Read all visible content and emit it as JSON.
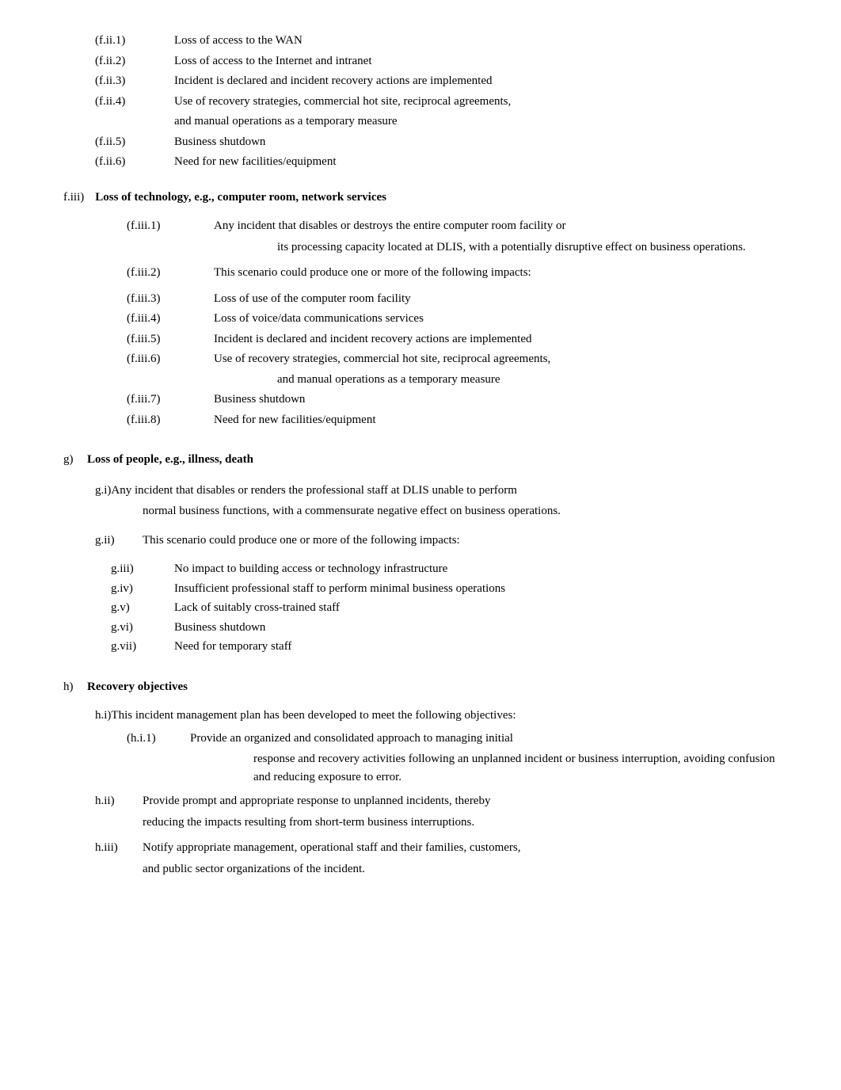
{
  "fii": {
    "items": [
      {
        "label": "(f.ii.1)",
        "text": "Loss of access to the WAN"
      },
      {
        "label": "(f.ii.2)",
        "text": "Loss of access to the Internet and intranet"
      },
      {
        "label": "(f.ii.3)",
        "text": "Incident is declared and incident recovery actions are implemented"
      },
      {
        "label": "(f.ii.4)",
        "text": "Use of recovery strategies, commercial hot site, reciprocal agreements,"
      },
      {
        "label": "",
        "continuation": "and manual operations as a temporary measure"
      },
      {
        "label": "(f.ii.5)",
        "text": "Business shutdown"
      },
      {
        "label": "(f.ii.6)",
        "text": "Need for new facilities/equipment"
      }
    ]
  },
  "fiii": {
    "header_label": "f.iii)",
    "header_title": "Loss of technology, e.g., computer room, network services",
    "items": [
      {
        "label": "(f.iii.1)",
        "text": "Any incident that disables or destroys the entire computer room facility or",
        "continuation": "its processing capacity located at DLIS, with a potentially disruptive effect on business operations."
      },
      {
        "label": "(f.iii.2)",
        "text": "This scenario could produce one or more of the following impacts:"
      },
      {
        "label": "(f.iii.3)",
        "text": "Loss of use of the computer room facility"
      },
      {
        "label": "(f.iii.4)",
        "text": "Loss of voice/data communications services"
      },
      {
        "label": "(f.iii.5)",
        "text": "Incident is declared and incident recovery actions are implemented"
      },
      {
        "label": "(f.iii.6)",
        "text": "Use of recovery strategies, commercial hot site, reciprocal agreements,"
      },
      {
        "label": "",
        "continuation": "and manual operations as a temporary measure"
      },
      {
        "label": "(f.iii.7)",
        "text": "Business shutdown"
      },
      {
        "label": "(f.iii.8)",
        "text": "Need for new facilities/equipment"
      }
    ]
  },
  "g": {
    "header_letter": "g)",
    "header_title": "Loss of people, e.g., illness, death",
    "gi_text": "g.i)Any incident that disables or renders the professional staff at DLIS unable to perform",
    "gi_continuation": "normal business functions, with a commensurate negative effect on business operations.",
    "gii_label": "g.ii)",
    "gii_text": "This scenario could produce one or more of the following impacts:",
    "impact_items": [
      {
        "label": "g.iii)",
        "text": "No impact to building access or technology infrastructure"
      },
      {
        "label": "g.iv)",
        "text": "Insufficient professional staff to perform minimal business operations"
      },
      {
        "label": "g.v)",
        "text": "Lack of suitably cross-trained staff"
      },
      {
        "label": "g.vi)",
        "text": "Business shutdown"
      },
      {
        "label": "g.vii)",
        "text": "Need for temporary staff"
      }
    ]
  },
  "h": {
    "header_letter": "h)",
    "header_title": "Recovery objectives",
    "hi_intro": "h.i)This incident management plan has been developed to meet the following objectives:",
    "hi_items": [
      {
        "label": "(h.i.1)",
        "text": "Provide an organized and consolidated approach to managing initial",
        "continuation": "response and recovery activities following an unplanned incident or business interruption, avoiding confusion and reducing exposure to error."
      }
    ],
    "hii_label": "h.ii)",
    "hii_text": "Provide prompt and appropriate response to unplanned incidents, thereby",
    "hii_continuation": "reducing the impacts resulting from short-term business interruptions.",
    "hiii_label": "h.iii)",
    "hiii_text": "Notify appropriate management, operational staff and their families, customers,",
    "hiii_continuation": "and public sector organizations of the incident."
  }
}
